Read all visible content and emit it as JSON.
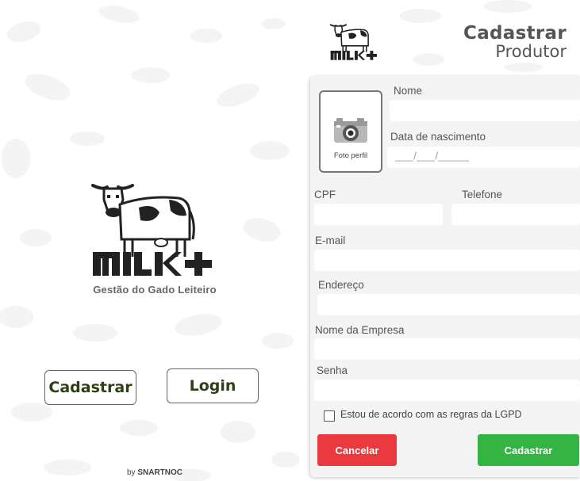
{
  "brand": {
    "logo_text": "MILK+",
    "tagline": "Gestão do Gado Leiteiro",
    "byline_prefix": "by",
    "byline_name": "SNARTNOC"
  },
  "landing": {
    "register_label": "Cadastrar",
    "login_label": "Login"
  },
  "header": {
    "title_line1": "Cadastrar",
    "title_line2": "Produtor"
  },
  "form": {
    "photo_label": "Foto perfil",
    "fields": {
      "nome": {
        "label": "Nome",
        "value": ""
      },
      "nascimento": {
        "label": "Data de nascimento",
        "mask": "___/___/_____"
      },
      "cpf": {
        "label": "CPF",
        "value": ""
      },
      "telefone": {
        "label": "Telefone",
        "value": ""
      },
      "email": {
        "label": "E-mail",
        "value": ""
      },
      "endereco": {
        "label": "Endereço",
        "value": ""
      },
      "empresa": {
        "label": "Nome da Empresa",
        "value": ""
      },
      "senha": {
        "label": "Senha",
        "value": ""
      }
    },
    "lgpd_label": "Estou de acordo com as regras da LGPD",
    "lgpd_checked": false,
    "cancel_label": "Cancelar",
    "submit_label": "Cadastrar"
  },
  "colors": {
    "cancel": "#ea3a3f",
    "submit": "#33b443",
    "brand_green": "#2e3f17",
    "form_bg": "#f3f3f3"
  }
}
